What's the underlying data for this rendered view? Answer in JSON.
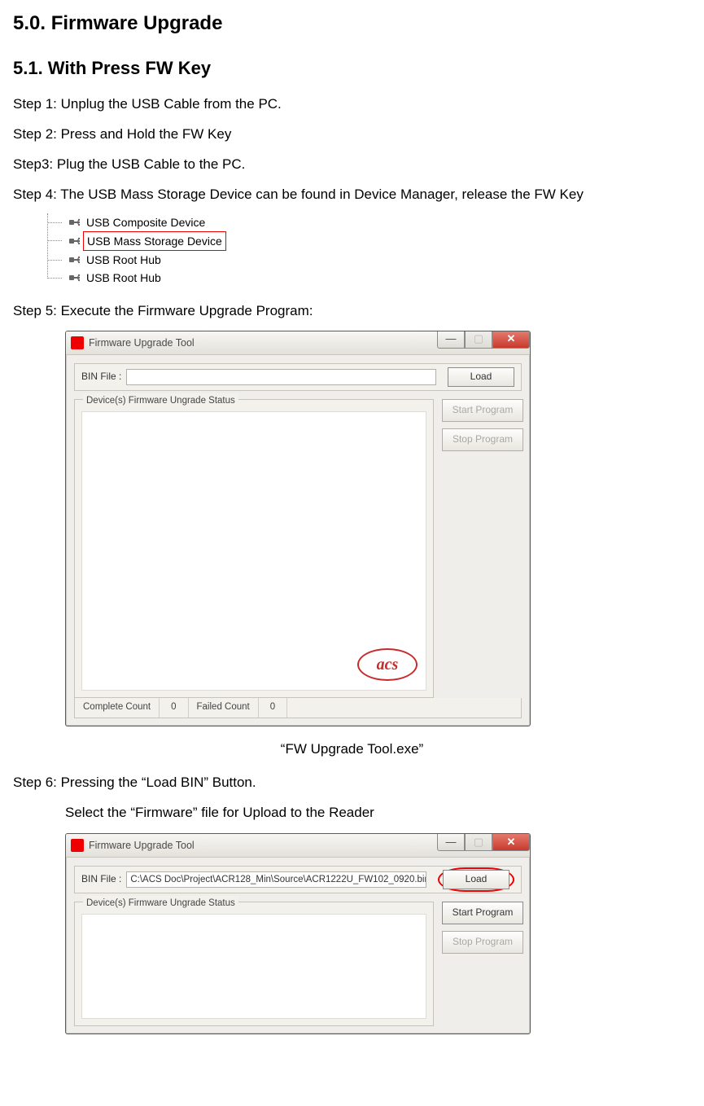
{
  "headings": {
    "section": "5.0. Firmware Upgrade",
    "subsection": "5.1.   With Press FW Key"
  },
  "steps": {
    "s1": "Step 1: Unplug the USB Cable from the PC.",
    "s2": "Step 2: Press and Hold the FW Key",
    "s3": "Step3: Plug the USB Cable to the PC.",
    "s4": "Step 4:  The USB Mass Storage Device can be found in Device Manager, release the FW Key",
    "s5": "Step 5: Execute the Firmware Upgrade Program:",
    "caption5": "“FW Upgrade Tool.exe”",
    "s6": "Step 6: Pressing the “Load BIN” Button.",
    "s6b": "Select the “Firmware” file for Upload to the Reader"
  },
  "device_tree": {
    "items": [
      {
        "label": "USB Composite Device",
        "highlight": false
      },
      {
        "label": "USB Mass Storage Device",
        "highlight": true
      },
      {
        "label": "USB Root Hub",
        "highlight": false
      },
      {
        "label": "USB Root Hub",
        "highlight": false
      }
    ]
  },
  "window": {
    "title": "Firmware Upgrade Tool",
    "bin_label": "BIN File :",
    "load_btn": "Load",
    "status_legend": "Device(s) Firmware Ungrade Status",
    "start_btn": "Start Program",
    "stop_btn": "Stop Program",
    "complete_label": "Complete Count",
    "complete_val": "0",
    "failed_label": "Failed Count",
    "failed_val": "0",
    "logo_text": "acs",
    "file_path": "C:\\ACS Doc\\Project\\ACR128_Min\\Source\\ACR1222U_FW102_0920.bin"
  }
}
